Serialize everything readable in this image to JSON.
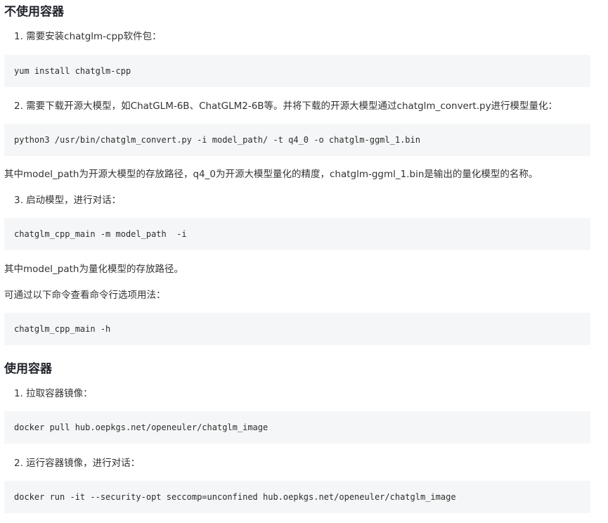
{
  "section1": {
    "title": "不使用容器",
    "step1": "1. 需要安装chatglm-cpp软件包：",
    "code1": "yum install chatglm-cpp",
    "step2": "2. 需要下载开源大模型，如ChatGLM-6B、ChatGLM2-6B等。并将下载的开源大模型通过chatglm_convert.py进行模型量化：",
    "code2": "python3 /usr/bin/chatglm_convert.py -i model_path/ -t q4_0 -o chatglm-ggml_1.bin",
    "note1": "其中model_path为开源大模型的存放路径，q4_0为开源大模型量化的精度，chatglm-ggml_1.bin是输出的量化模型的名称。",
    "step3": "3. 启动模型，进行对话：",
    "code3": "chatglm_cpp_main -m model_path  -i",
    "note2": "其中model_path为量化模型的存放路径。",
    "note3": "可通过以下命令查看命令行选项用法：",
    "code4": "chatglm_cpp_main -h"
  },
  "section2": {
    "title": "使用容器",
    "step1": "1. 拉取容器镜像：",
    "code1": "docker pull hub.oepkgs.net/openeuler/chatglm_image",
    "step2": "2. 运行容器镜像，进行对话：",
    "code2": "docker run -it --security-opt seccomp=unconfined hub.oepkgs.net/openeuler/chatglm_image"
  }
}
